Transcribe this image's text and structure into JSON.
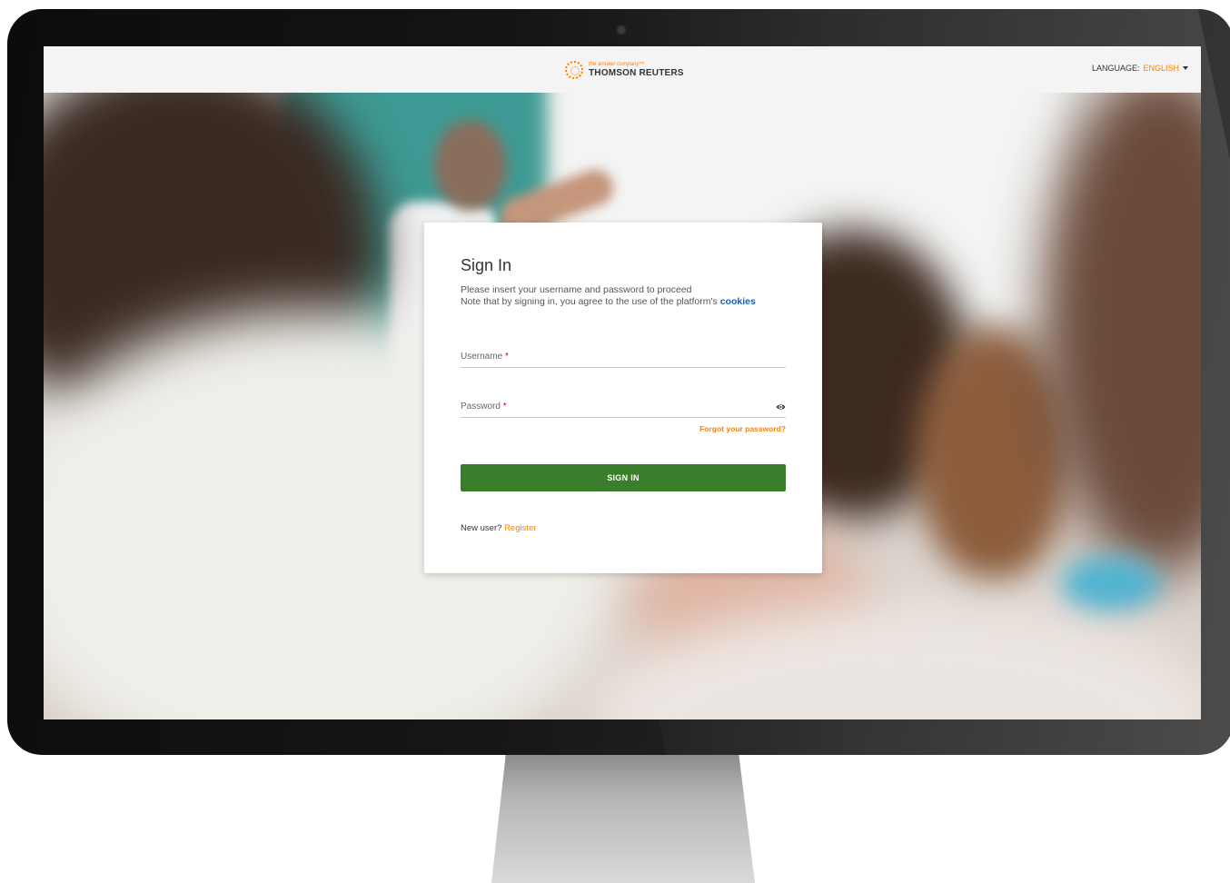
{
  "header": {
    "logo_tagline": "the answer company™",
    "logo_name": "THOMSON REUTERS",
    "language_label": "LANGUAGE:",
    "language_value": "ENGLISH"
  },
  "icons": {
    "logo": "thomson-reuters-logo-icon",
    "language_caret": "caret-down-icon",
    "password_toggle": "eye-icon"
  },
  "login": {
    "title": "Sign In",
    "subtitle_line1": "Please insert your username and password to proceed",
    "subtitle_line2": "Note that by signing in, you agree to the use of the platform's",
    "cookies_link": "cookies",
    "username_label": "Username",
    "password_label": "Password",
    "required_mark": "*",
    "forgot_link": "Forgot your password?",
    "signin_button": "SIGN IN",
    "new_user_text": "New user?",
    "register_link": "Register"
  },
  "colors": {
    "accent_orange": "#ff8000",
    "button_green": "#3a7d2a",
    "link_blue": "#1a5fa8",
    "required_red": "#d0021b"
  }
}
